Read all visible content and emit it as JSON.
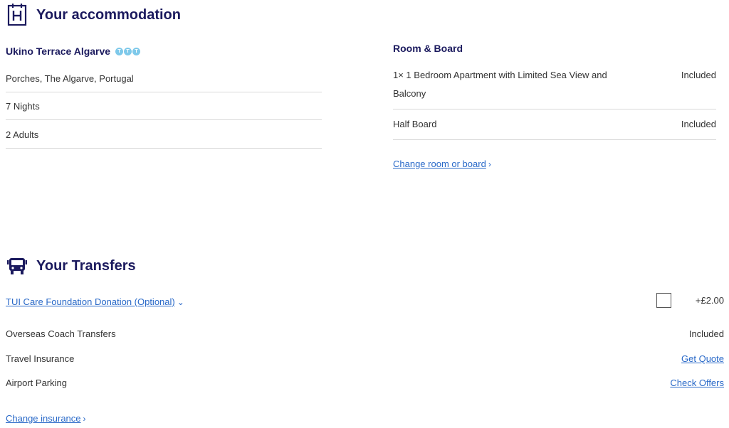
{
  "accommodation": {
    "heading": "Your accommodation",
    "hotel_name": "Ukino Terrace Algarve",
    "rating": [
      "T",
      "T",
      "T"
    ],
    "location": "Porches, The Algarve, Portugal",
    "nights": "7 Nights",
    "guests": "2  Adults"
  },
  "room_board": {
    "title": "Room & Board",
    "items": [
      {
        "label": "1× 1 Bedroom Apartment with Limited Sea View and Balcony",
        "status": "Included"
      },
      {
        "label": "Half Board",
        "status": "Included"
      }
    ],
    "change_link": "Change room or board"
  },
  "transfers": {
    "heading": "Your Transfers",
    "donation_link": "TUI Care Foundation Donation (Optional)",
    "donation_price": "+£2.00",
    "rows": [
      {
        "label": "Overseas Coach Transfers",
        "value": "Included"
      },
      {
        "label": "Travel Insurance",
        "value": "Get Quote"
      },
      {
        "label": "Airport Parking",
        "value": "Check Offers"
      }
    ],
    "change_insurance": "Change insurance"
  },
  "colors": {
    "navy": "#1b1a5e",
    "link": "#2969c8",
    "rating": "#7ec9ea"
  },
  "icons": {
    "accommodation": "hotel-icon",
    "transfers": "bus-icon"
  }
}
